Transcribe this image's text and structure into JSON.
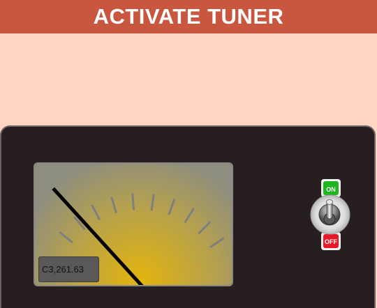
{
  "header": {
    "title": "ACTIVATE TUNER"
  },
  "meter": {
    "readout": "C3,261.63",
    "needle_level": 0.09,
    "tick_count": 10
  },
  "power_switch": {
    "on_label": "ON",
    "off_label": "OFF",
    "on_color": "#1fb51f",
    "off_color": "#e8182a"
  },
  "colors": {
    "background": "#fed4c2",
    "header": "#c95740",
    "panel": "#271f1f",
    "meter_glow": "#e3b40d"
  }
}
